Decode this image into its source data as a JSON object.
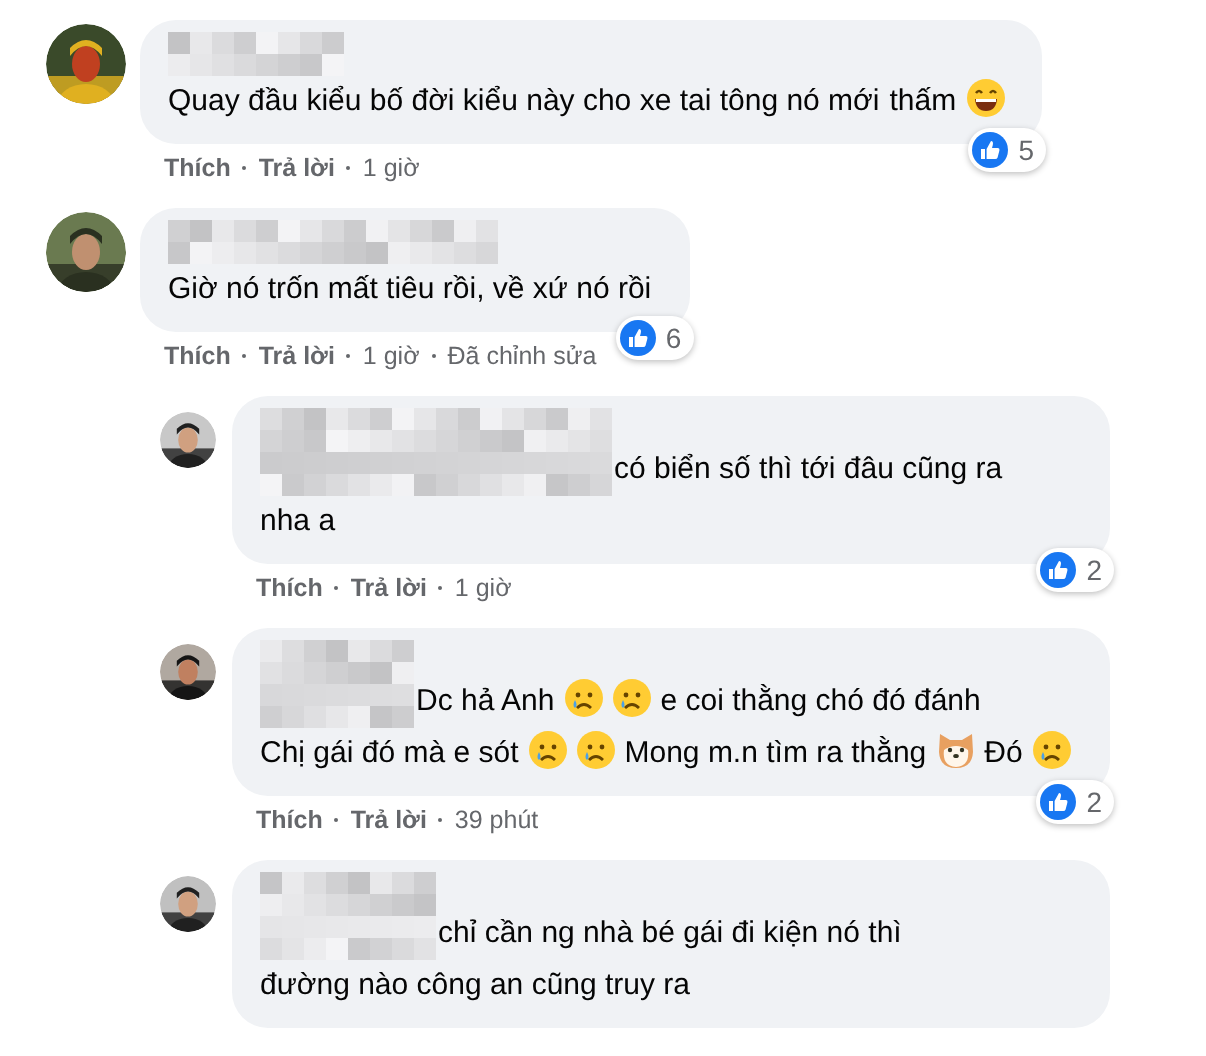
{
  "comments": [
    {
      "kind": "top",
      "name_hidden": true,
      "parts": [
        {
          "kind": "text",
          "text": "Quay đầu kiểu bố đời kiểu này cho xe tai tông nó mới"
        },
        {
          "kind": "text",
          "text": "thấm"
        },
        {
          "kind": "grin"
        }
      ],
      "likes": "5",
      "like_label": "Thích",
      "reply_label": "Trả lời",
      "time": "1 giờ"
    },
    {
      "kind": "top",
      "name_hidden": true,
      "parts": [
        {
          "kind": "text",
          "text": "Giờ nó trốn mất tiêu rồi, về xứ nó rồi"
        }
      ],
      "likes": "6",
      "like_label": "Thích",
      "reply_label": "Trả lời",
      "time": "1 giờ",
      "edited": "Đã chỉnh sửa"
    },
    {
      "kind": "reply",
      "name_hidden": true,
      "parts": [
        {
          "kind": "text",
          "text": "có biển số thì tới đâu cũng ra"
        },
        {
          "kind": "text",
          "text": "nha a"
        }
      ],
      "likes": "2",
      "like_label": "Thích",
      "reply_label": "Trả lời",
      "time": "1 giờ"
    },
    {
      "kind": "reply",
      "name_hidden": true,
      "parts": [
        {
          "kind": "text",
          "text": "Dc hả Anh"
        },
        {
          "kind": "cry"
        },
        {
          "kind": "cry"
        },
        {
          "kind": "text",
          "text": "e coi thằng chó đó đánh"
        },
        {
          "kind": "text",
          "text": "Chị gái đó mà e sót"
        },
        {
          "kind": "cry"
        },
        {
          "kind": "cry"
        },
        {
          "kind": "text",
          "text": "Mong m.n tìm ra thằng"
        },
        {
          "kind": "dog"
        },
        {
          "kind": "text",
          "text": "Đó"
        },
        {
          "kind": "cry"
        }
      ],
      "likes": "2",
      "like_label": "Thích",
      "reply_label": "Trả lời",
      "time": "39 phút"
    },
    {
      "kind": "reply",
      "name_hidden": true,
      "parts": [
        {
          "kind": "text",
          "text": "chỉ cần ng nhà bé gái đi kiện nó thì"
        },
        {
          "kind": "text",
          "text": "đường nào công an cũng truy ra"
        }
      ]
    }
  ]
}
